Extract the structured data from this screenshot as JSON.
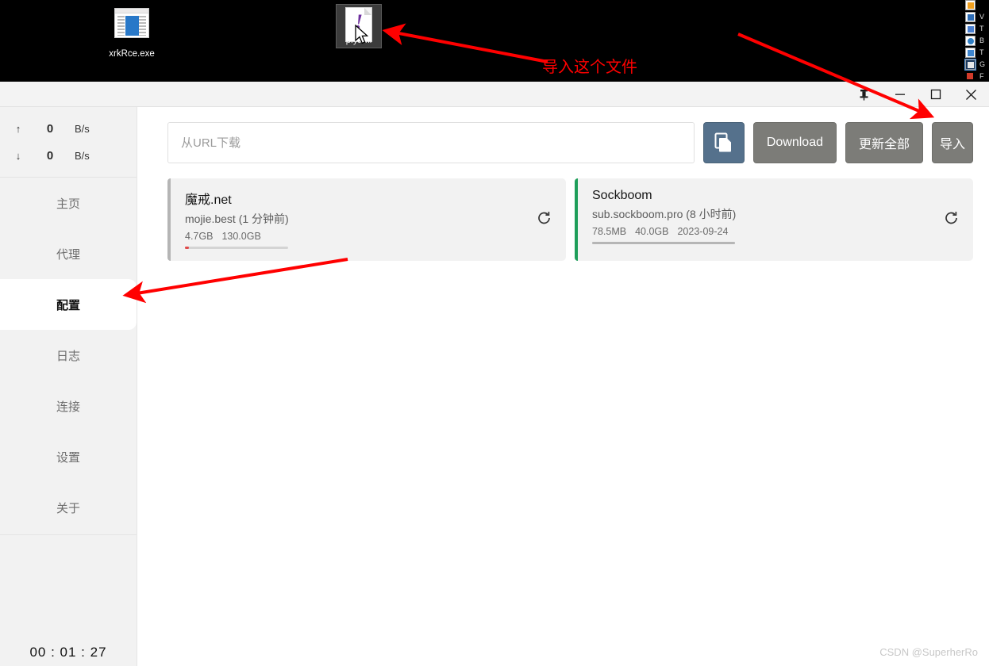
{
  "desktop": {
    "icons": [
      {
        "name": "xrkRce.exe",
        "type": "exe-icon"
      },
      {
        "name": "p.yaml",
        "type": "yaml-file-icon",
        "selected": true
      }
    ],
    "right_strip_labels": [
      "",
      "V",
      "T",
      "B",
      "T",
      "G",
      "F"
    ],
    "cursor": "pointer-arrow"
  },
  "annotations": {
    "import_file_text": "导入这个文件",
    "arrow_color": "#ff0000"
  },
  "titlebar": {
    "pin": "📌",
    "minimize": "—",
    "maximize": "□",
    "close": "✕"
  },
  "sidebar": {
    "upload": {
      "arrow": "↑",
      "value": "0",
      "unit": "B/s"
    },
    "download": {
      "arrow": "↓",
      "value": "0",
      "unit": "B/s"
    },
    "items": [
      {
        "label": "主页",
        "active": false
      },
      {
        "label": "代理",
        "active": false
      },
      {
        "label": "配置",
        "active": true
      },
      {
        "label": "日志",
        "active": false
      },
      {
        "label": "连接",
        "active": false
      },
      {
        "label": "设置",
        "active": false
      },
      {
        "label": "关于",
        "active": false
      }
    ],
    "timer": "00 : 01 : 27"
  },
  "toolbar": {
    "url_placeholder": "从URL下载",
    "url_value": "",
    "copy_icon": "copy-icon",
    "download_label": "Download",
    "update_all_label": "更新全部",
    "import_label": "导入"
  },
  "profiles": [
    {
      "title": "魔戒.net",
      "subtitle": "mojie.best (1 分钟前)",
      "used": "4.7GB",
      "total": "130.0GB",
      "expire": "",
      "accent": "#b5b5b5",
      "bar_color": "#e04a4a",
      "bar_percent": 3.6,
      "refresh_icon": "refresh-icon"
    },
    {
      "title": "Sockboom",
      "subtitle": "sub.sockboom.pro (8 小时前)",
      "used": "78.5MB",
      "total": "40.0GB",
      "expire": "2023-09-24",
      "accent": "#1e9e5a",
      "bar_color": "#b6b6b6",
      "bar_percent": 100,
      "refresh_icon": "refresh-icon"
    }
  ],
  "watermark": "CSDN @SuperherRo"
}
